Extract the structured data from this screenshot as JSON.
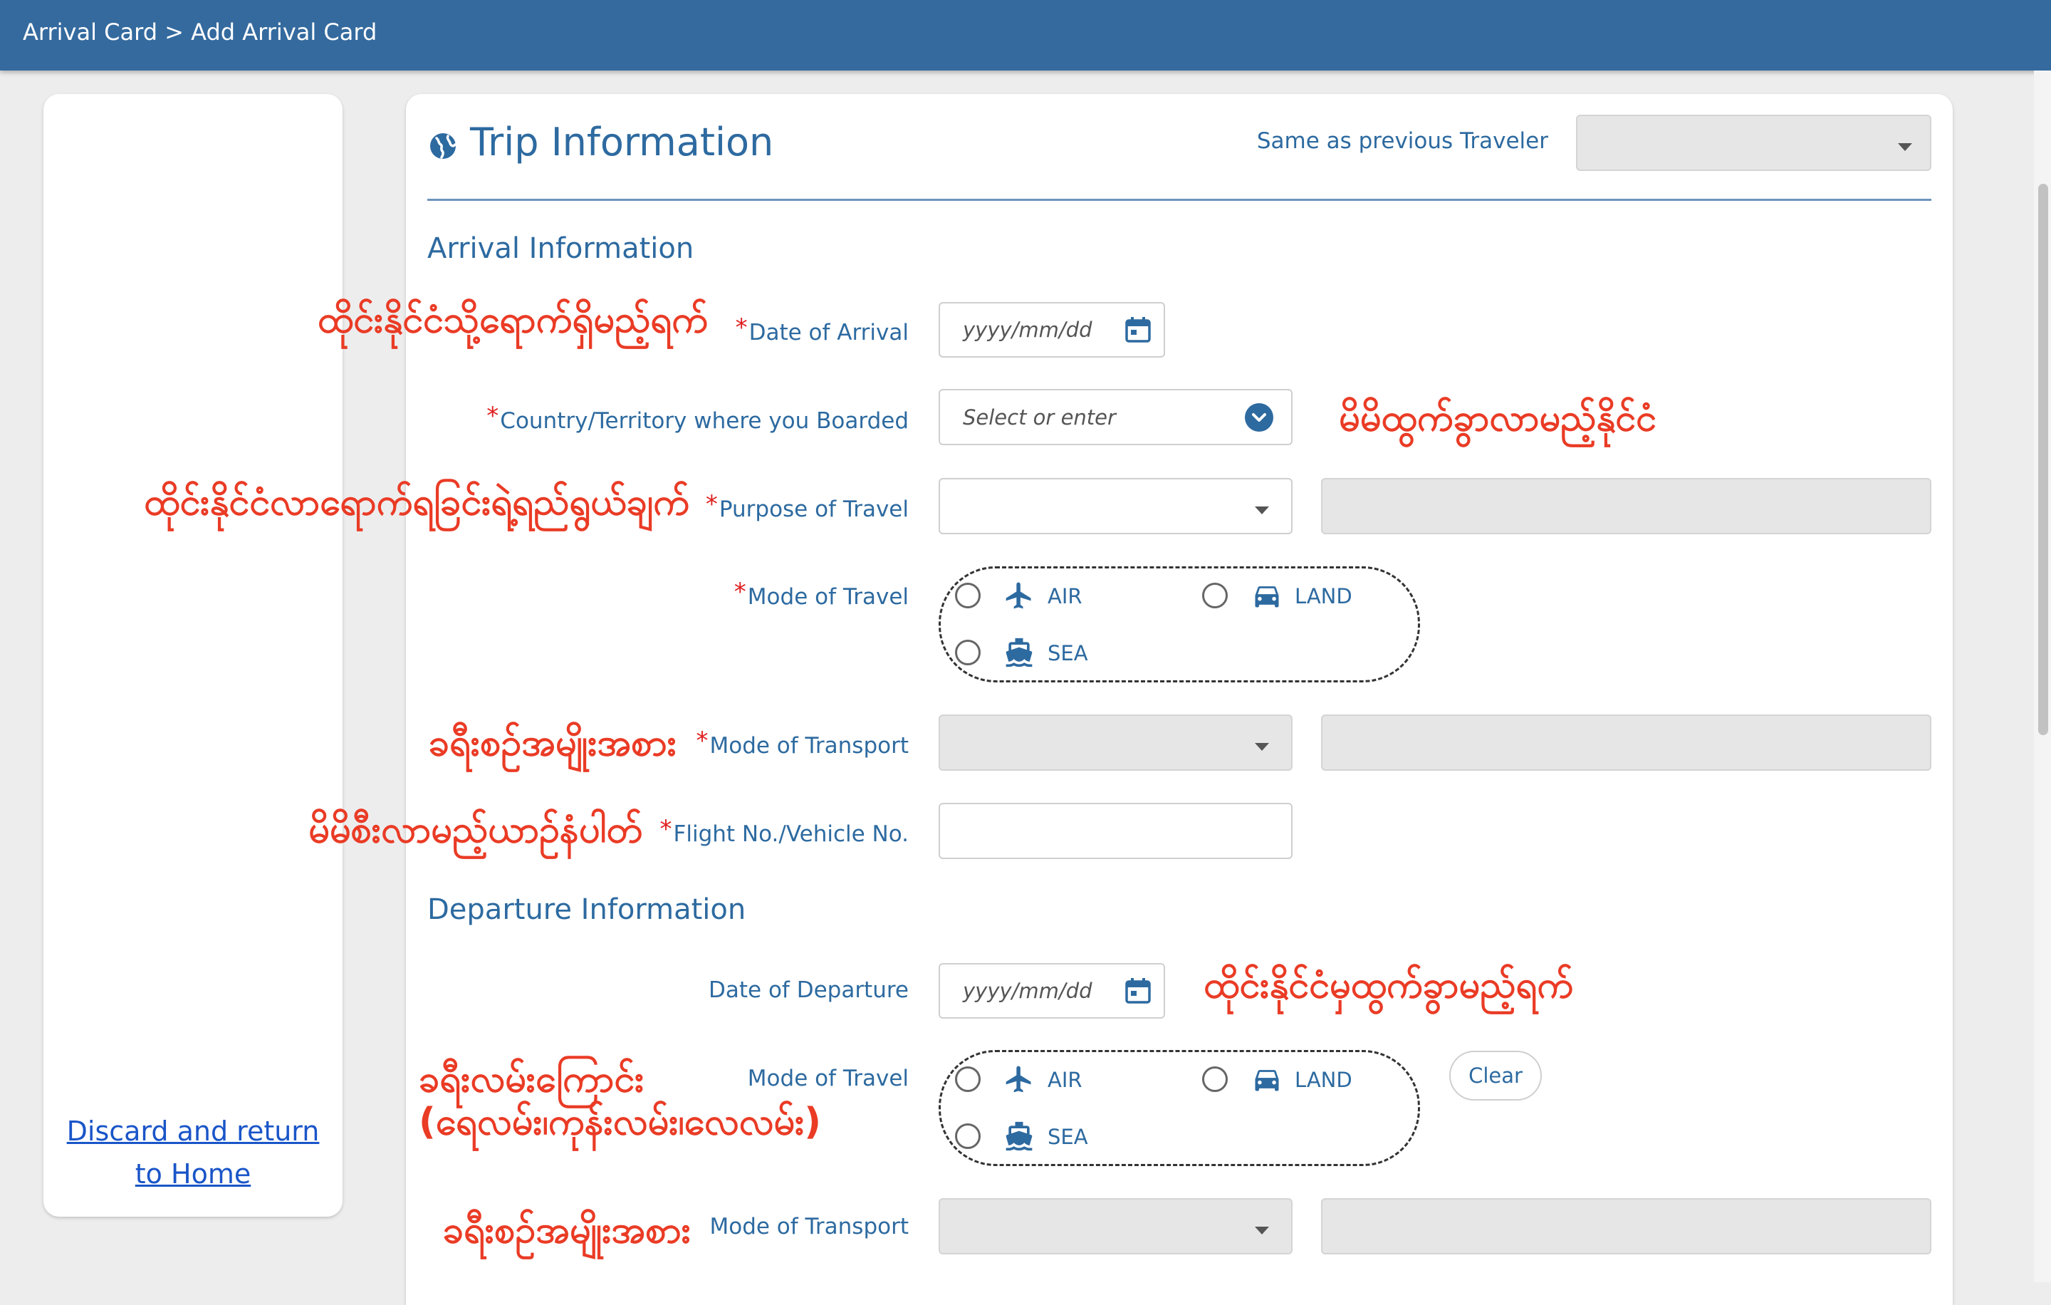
{
  "header": {
    "breadcrumb": "Arrival Card > Add Arrival Card"
  },
  "left_panel": {
    "discard_line1": "Discard and return",
    "discard_line2": "to Home"
  },
  "trip": {
    "title": "Trip Information",
    "same_as_label": "Same as previous Traveler",
    "same_as_value": ""
  },
  "arrival": {
    "heading": "Arrival Information",
    "date_label": "Date of Arrival",
    "date_placeholder": "yyyy/mm/dd",
    "country_label": "Country/Territory where you Boarded",
    "country_placeholder": "Select or enter",
    "purpose_label": "Purpose of Travel",
    "purpose_value": "",
    "purpose_other": "",
    "mode_label": "Mode of Travel",
    "mode_options": {
      "air": "AIR",
      "land": "LAND",
      "sea": "SEA"
    },
    "transport_label": "Mode of Transport",
    "transport_value": "",
    "transport_other": "",
    "flight_label": "Flight No./Vehicle No.",
    "flight_value": ""
  },
  "departure": {
    "heading": "Departure Information",
    "date_label": "Date of Departure",
    "date_placeholder": "yyyy/mm/dd",
    "mode_label": "Mode of Travel",
    "mode_options": {
      "air": "AIR",
      "land": "LAND",
      "sea": "SEA"
    },
    "clear_label": "Clear",
    "transport_label": "Mode of Transport",
    "transport_value": "",
    "transport_other": ""
  },
  "annotations": {
    "date_arrival": "ထိုင်းနိုင်ငံသို့ရောက်ရှိမည့်ရက်",
    "country_boarded": "မိမိထွက်ခွာလာမည့်နိုင်ငံ",
    "purpose": "ထိုင်းနိုင်ငံလာရောက်ရခြင်းရဲ့ရည်ရွယ်ချက်",
    "transport_arrival": "ခရီးစဥ်အမျိုးအစား",
    "flight_no": "မိမိစီးလာမည့်ယာဥ်နံပါတ်",
    "date_departure": "ထိုင်းနိုင်ငံမှထွက်ခွာမည့်ရက်",
    "route_line1": "ခရီးလမ်းကြောင်း",
    "route_line2": "(ရေလမ်း၊ကုန်းလမ်း၊လေလမ်း)",
    "transport_departure": "ခရီးစဥ်အမျိုးအစား"
  },
  "colors": {
    "header_bg": "#346a9e",
    "accent": "#2d6aa0",
    "required": "#e02020",
    "annotation": "#ea3b25",
    "link": "#1a55c8"
  },
  "icons": {
    "trip": "globe-icon",
    "date": "calendar-icon",
    "dropdown": "caret-down-icon",
    "country": "chevron-down-circle-icon",
    "air": "airplane-icon",
    "land": "car-icon",
    "sea": "ship-icon"
  }
}
